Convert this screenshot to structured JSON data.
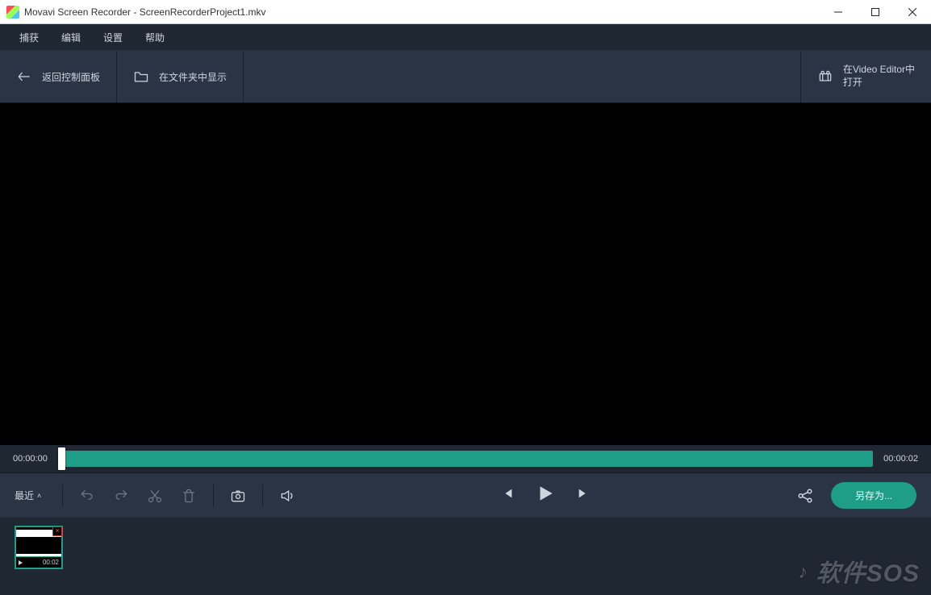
{
  "window": {
    "title": "Movavi Screen Recorder - ScreenRecorderProject1.mkv"
  },
  "menu": {
    "capture": "捕获",
    "edit": "编辑",
    "settings": "设置",
    "help": "帮助"
  },
  "actions": {
    "back": "返回控制面板",
    "showInFolder": "在文件夹中显示",
    "openInEditorLine1": "在Video Editor中",
    "openInEditorLine2": "打开"
  },
  "timeline": {
    "start": "00:00:00",
    "end": "00:00:02"
  },
  "controls": {
    "recent": "最近",
    "saveAs": "另存为..."
  },
  "thumb": {
    "duration": "00:02"
  },
  "watermark": "软件SOS"
}
